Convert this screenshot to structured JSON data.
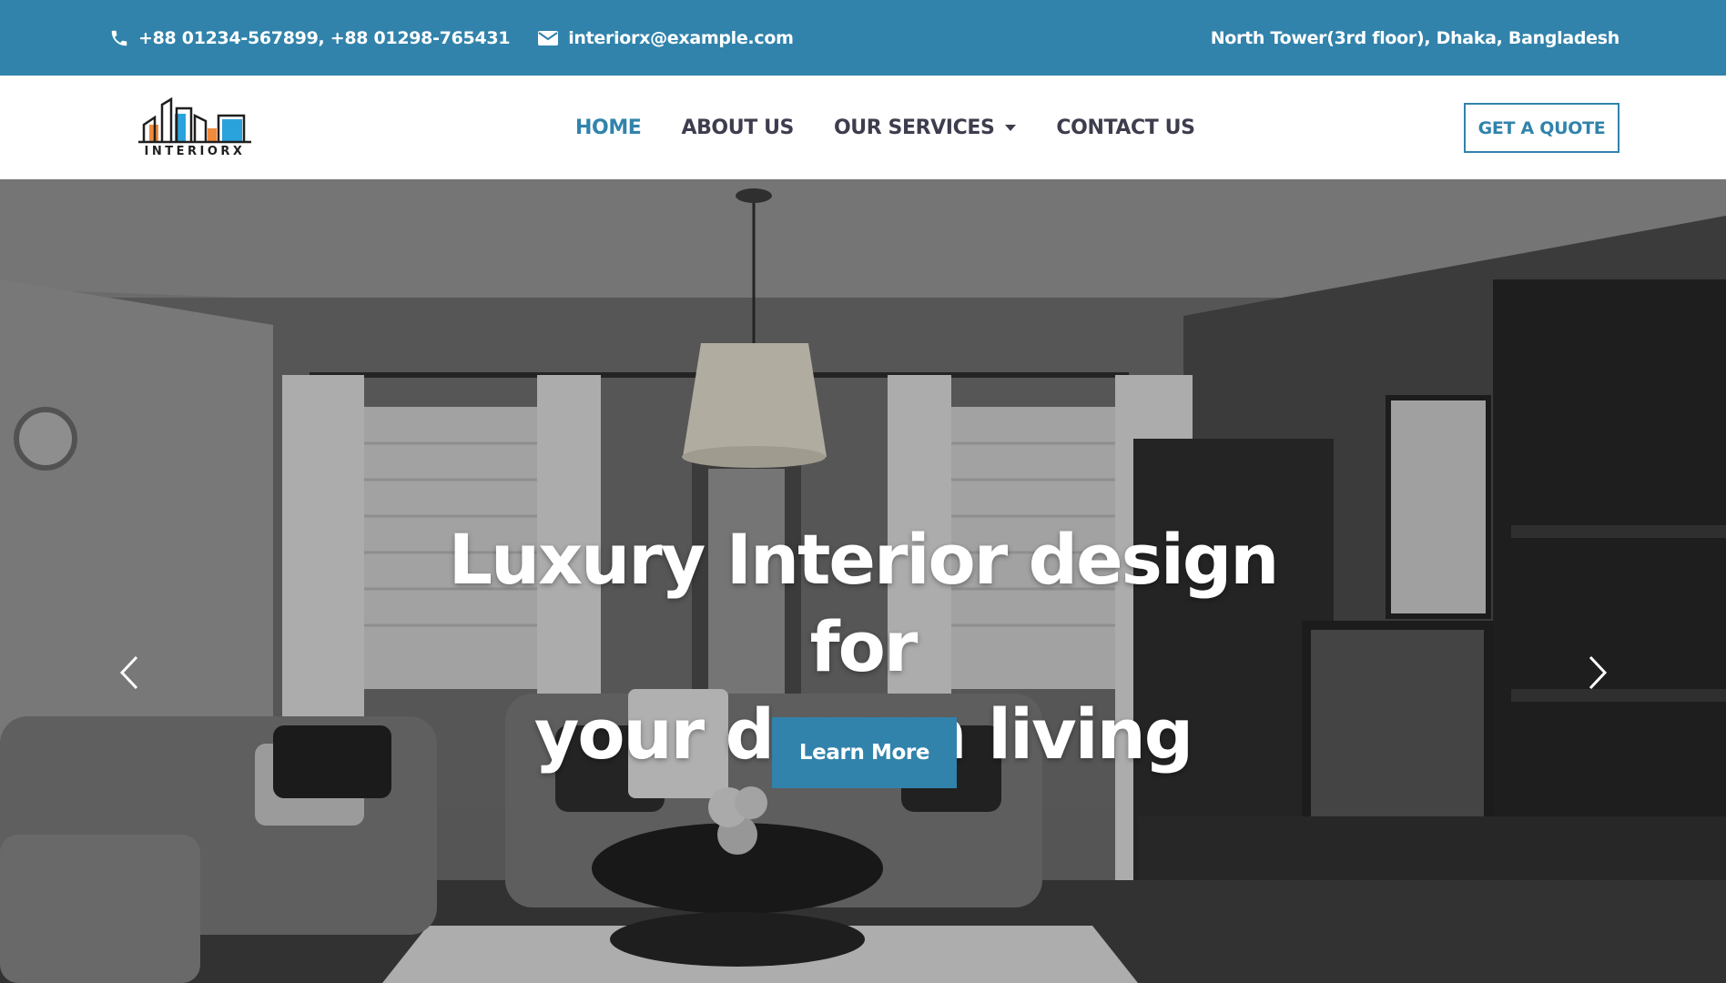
{
  "topbar": {
    "phone": "+88 01234-567899, +88 01298-765431",
    "email": "interiorx@example.com",
    "address": "North Tower(3rd floor), Dhaka, Bangladesh",
    "icons": [
      "phone-icon",
      "envelope-icon"
    ]
  },
  "brand": {
    "logo_text": "INTERIORX"
  },
  "nav": {
    "items": [
      {
        "label": "HOME",
        "active": true
      },
      {
        "label": "ABOUT US",
        "active": false
      },
      {
        "label": "OUR SERVICES",
        "active": false,
        "dropdown": true
      },
      {
        "label": "CONTACT US",
        "active": false
      }
    ],
    "cta": "GET A QUOTE"
  },
  "hero": {
    "title_line1": "Luxury Interior design for",
    "title_line2": "your dream living",
    "button": "Learn More",
    "icons": [
      "chevron-left-icon",
      "chevron-right-icon"
    ]
  },
  "colors": {
    "accent": "#3183ab",
    "nav_text": "#3d3d4e",
    "white": "#ffffff"
  }
}
